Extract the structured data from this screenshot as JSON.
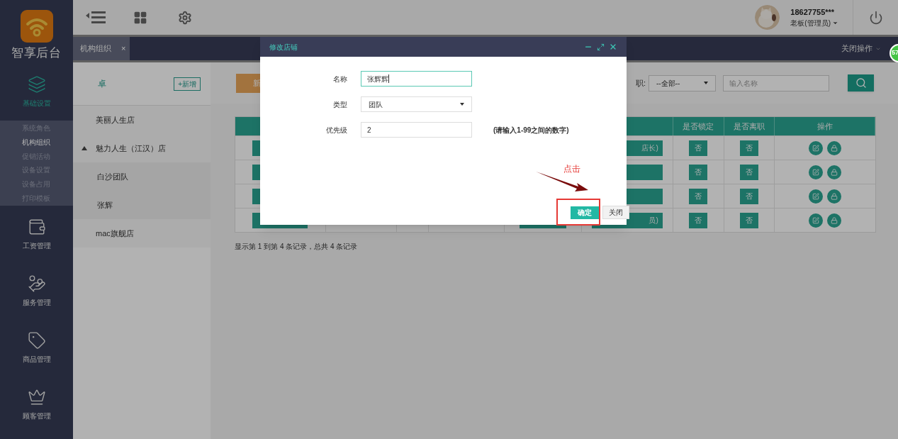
{
  "sidebar": {
    "logo_text": "智享后台",
    "modules": [
      {
        "label": "基础设置",
        "selected": true,
        "submenu": [
          {
            "label": "系统角色",
            "selected": false
          },
          {
            "label": "机构组织",
            "selected": true
          },
          {
            "label": "促销活动",
            "selected": false
          },
          {
            "label": "设备设置",
            "selected": false
          },
          {
            "label": "设备占用",
            "selected": false
          },
          {
            "label": "打印模板",
            "selected": false
          }
        ]
      },
      {
        "label": "工资管理",
        "selected": false
      },
      {
        "label": "服务管理",
        "selected": false
      },
      {
        "label": "商品管理",
        "selected": false
      },
      {
        "label": "顾客管理",
        "selected": false
      }
    ]
  },
  "user": {
    "phone": "18627755***",
    "role": "老板(管理员)"
  },
  "tabs": [
    {
      "label": "机构组织",
      "selected": true,
      "close": "×"
    }
  ],
  "close_ops": "关闭操作",
  "badge": "57",
  "tree": {
    "title": "卓",
    "add_button": "+新增",
    "items": [
      {
        "label": "美丽人生店"
      },
      {
        "label": "魅力人生（江汉）店",
        "expanded": true,
        "children": [
          {
            "label": "白沙团队"
          },
          {
            "label": "张辉"
          }
        ]
      },
      {
        "label": "mac旗舰店"
      }
    ]
  },
  "filter": {
    "new_button": "新",
    "label": "职:",
    "select": "--全部--",
    "search_placeholder": "输入名称"
  },
  "table": {
    "columns": [
      "是否锁定",
      "是否离职",
      "操作"
    ],
    "rows": [
      {
        "column_6": "店长)",
        "locked": "否",
        "left": "否"
      },
      {
        "locked": "否",
        "left": "否"
      },
      {
        "locked": "否",
        "left": "否"
      },
      {
        "column_6": "员)",
        "locked": "否",
        "left": "否"
      }
    ],
    "footer": "显示第 1 到第 4 条记录，总共 4 条记录"
  },
  "dialog": {
    "title": "修改店铺",
    "fields": [
      {
        "label": "名称",
        "kind": "text",
        "value": "张辉辉",
        "focused": true
      },
      {
        "label": "类型",
        "kind": "select",
        "value": "团队",
        "focused": false
      },
      {
        "label": "优先级",
        "kind": "text",
        "value": "2",
        "focused": false,
        "hint": "(请输入1-99之间的数字)"
      }
    ],
    "confirm": "确定",
    "close": "关闭"
  },
  "annotation": {
    "text": "点击"
  }
}
